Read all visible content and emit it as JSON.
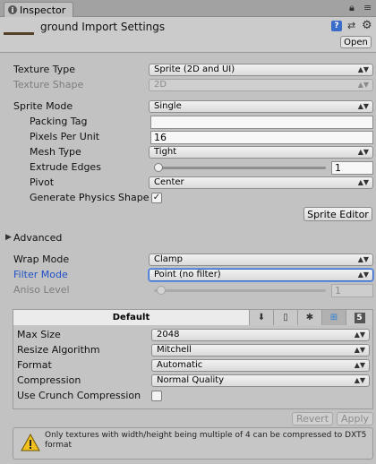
{
  "tab": {
    "label": "Inspector"
  },
  "header": {
    "title": "ground Import Settings",
    "open_label": "Open",
    "help_icon": "?",
    "preset_icon": "⇄",
    "gear_icon": "⚙"
  },
  "texture": {
    "type_label": "Texture Type",
    "type_value": "Sprite (2D and UI)",
    "shape_label": "Texture Shape",
    "shape_value": "2D"
  },
  "sprite": {
    "mode_label": "Sprite Mode",
    "mode_value": "Single",
    "packing_tag_label": "Packing Tag",
    "packing_tag_value": "",
    "ppu_label": "Pixels Per Unit",
    "ppu_value": "16",
    "mesh_type_label": "Mesh Type",
    "mesh_type_value": "Tight",
    "extrude_label": "Extrude Edges",
    "extrude_value": "1",
    "extrude_fraction": 0.0625,
    "pivot_label": "Pivot",
    "pivot_value": "Center",
    "physics_shape_label": "Generate Physics Shape",
    "physics_shape_checked": "✓",
    "editor_button": "Sprite Editor"
  },
  "advanced": {
    "label": "Advanced"
  },
  "wrap": {
    "label": "Wrap Mode",
    "value": "Clamp"
  },
  "filter": {
    "label": "Filter Mode",
    "value": "Point (no filter)"
  },
  "aniso": {
    "label": "Aniso Level",
    "value": "1",
    "fraction": 0.0625
  },
  "platform": {
    "default_tab": "Default",
    "tabs": [
      {
        "icon": "download-icon",
        "glyph": "⬇"
      },
      {
        "icon": "phone-icon",
        "glyph": "▯"
      },
      {
        "icon": "android-icon",
        "glyph": "✱"
      },
      {
        "icon": "windows-icon",
        "glyph": "⊞"
      },
      {
        "icon": "html5-icon",
        "glyph": "5"
      }
    ],
    "max_size_label": "Max Size",
    "max_size_value": "2048",
    "resize_label": "Resize Algorithm",
    "resize_value": "Mitchell",
    "format_label": "Format",
    "format_value": "Automatic",
    "compression_label": "Compression",
    "compression_value": "Normal Quality",
    "crunch_label": "Use Crunch Compression"
  },
  "actions": {
    "revert": "Revert",
    "apply": "Apply"
  },
  "warning": {
    "text": "Only textures with width/height being multiple of 4 can be compressed to DXT5 format"
  },
  "colors": {
    "panel": "#c2c2c2",
    "focus_blue": "#2050c8",
    "help_blue": "#3a6dc9"
  }
}
